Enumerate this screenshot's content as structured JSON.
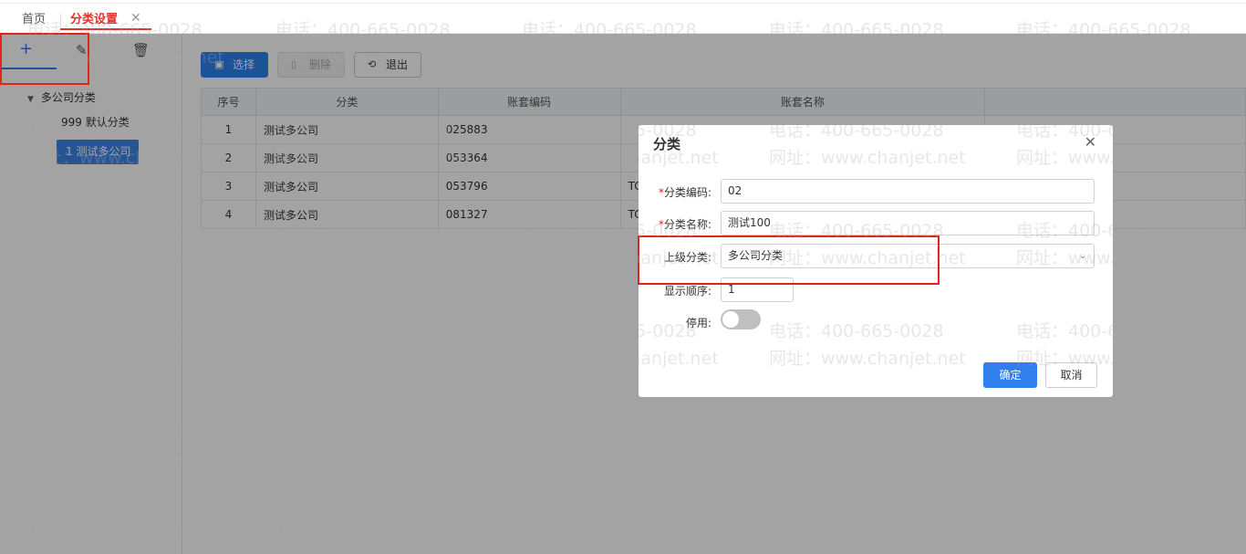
{
  "tabs": {
    "home": "首页",
    "active": "分类设置",
    "close": "✕"
  },
  "tree_toolbar": {
    "add": "+",
    "edit": "✎",
    "delete": "🗑"
  },
  "tree": {
    "root": "多公司分类",
    "children": [
      "999 默认分类",
      "1 测试多公司"
    ]
  },
  "toolbar": {
    "select": "选择",
    "delete": "删除",
    "exit": "退出"
  },
  "table": {
    "headers": [
      "序号",
      "分类",
      "账套编码",
      "账套名称",
      ""
    ],
    "rows": [
      {
        "no": "1",
        "category": "测试多公司",
        "code": "025883",
        "name": ""
      },
      {
        "no": "2",
        "category": "测试多公司",
        "code": "053364",
        "name": ""
      },
      {
        "no": "3",
        "category": "测试多公司",
        "code": "053796",
        "name": "TC"
      },
      {
        "no": "4",
        "category": "测试多公司",
        "code": "081327",
        "name": "TC"
      }
    ]
  },
  "dialog": {
    "title": "分类",
    "fields": {
      "code": {
        "label": "分类编码:",
        "value": "02"
      },
      "name": {
        "label": "分类名称:",
        "value": "测试100"
      },
      "parent": {
        "label": "上级分类:",
        "value": "多公司分类"
      },
      "order": {
        "label": "显示顺序:",
        "value": "1"
      },
      "disabled": {
        "label": "停用:",
        "on": false
      }
    },
    "ok": "确定",
    "cancel": "取消"
  },
  "watermark": {
    "phone": "电话：400-665-0028",
    "site": "网址：www.chanjet.net"
  }
}
